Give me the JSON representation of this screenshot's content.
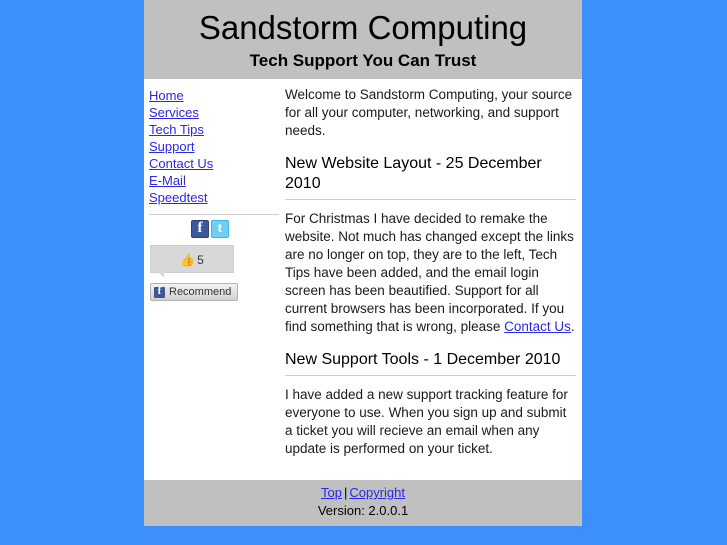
{
  "header": {
    "title": "Sandstorm Computing",
    "tagline": "Tech Support You Can Trust"
  },
  "sidebar": {
    "nav": [
      {
        "label": "Home"
      },
      {
        "label": "Services"
      },
      {
        "label": "Tech Tips"
      },
      {
        "label": "Support"
      },
      {
        "label": "Contact Us"
      },
      {
        "label": "E-Mail"
      },
      {
        "label": "Speedtest"
      }
    ],
    "social": {
      "facebook_icon": "facebook-icon",
      "twitter_icon": "twitter-icon"
    },
    "facebook_widget": {
      "thumb_icon": "👍",
      "like_count": "5",
      "recommend_label": "Recommend"
    }
  },
  "content": {
    "intro": "Welcome to Sandstorm Computing, your source for all your computer, networking, and support needs.",
    "articles": [
      {
        "title": "New Website Layout - 25 December 2010",
        "body_before_link": "For Christmas I have decided to remake the website. Not much has changed except the links are no longer on top, they are to the left, Tech Tips have been added, and the email login screen has been beautified. Support for all current browsers has been incorporated. If you find something that is wrong, please ",
        "link_label": "Contact Us",
        "body_after_link": "."
      },
      {
        "title": "New Support Tools - 1 December 2010",
        "body": "I have added a new support tracking feature for everyone to use. When you sign up and submit a ticket you will recieve an email when any update is performed on your ticket."
      }
    ]
  },
  "footer": {
    "top_label": "Top",
    "separator": "|",
    "copyright_label": "Copyright",
    "version": "Version: 2.0.0.1"
  },
  "colors": {
    "page_background": "#3d90fc",
    "panel_background": "#ffffff",
    "header_background": "#c0c0c0",
    "link": "#2b28e8",
    "facebook_blue": "#3b5998",
    "twitter_blue": "#6ecff6"
  }
}
